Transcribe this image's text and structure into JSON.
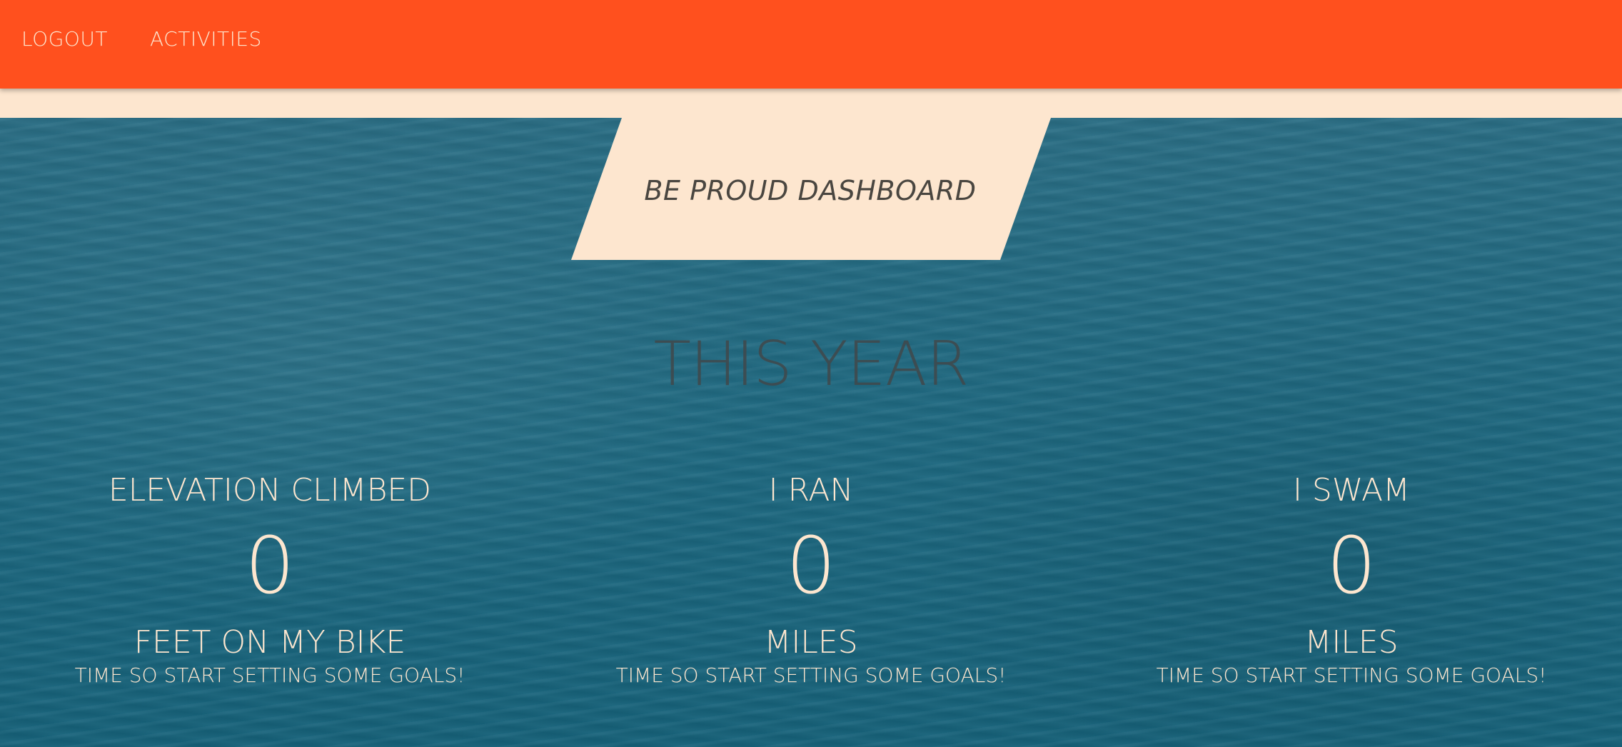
{
  "nav": {
    "logout": "LOGOUT",
    "activities": "ACTIVITIES"
  },
  "banner": {
    "title": "BE PROUD DASHBOARD"
  },
  "section": {
    "title": "THIS YEAR"
  },
  "stats": [
    {
      "label": "ELEVATION CLIMBED",
      "value": "0",
      "unit": "FEET ON MY BIKE",
      "note": "TIME SO START SETTING SOME GOALS!"
    },
    {
      "label": "I RAN",
      "value": "0",
      "unit": "MILES",
      "note": "TIME SO START SETTING SOME GOALS!"
    },
    {
      "label": "I SWAM",
      "value": "0",
      "unit": "MILES",
      "note": "TIME SO START SETTING SOME GOALS!"
    }
  ],
  "colors": {
    "navbar": "#ff501e",
    "cream": "#fde6cf",
    "ocean": "#1e6981",
    "dark_text": "#4a4640"
  }
}
